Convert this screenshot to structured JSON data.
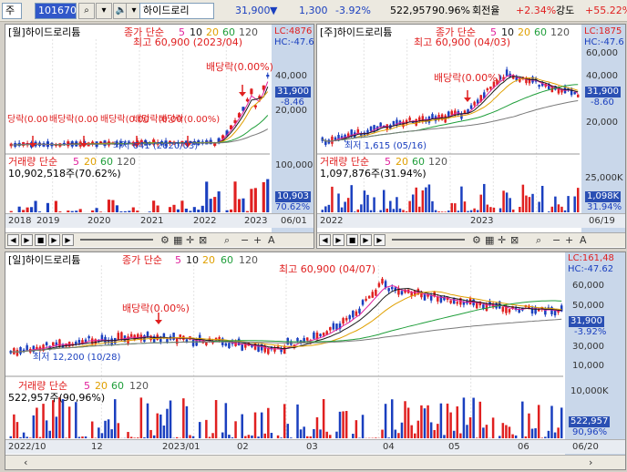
{
  "toolbar": {
    "market": "주",
    "code": "101670",
    "name": "하이드로리",
    "price": "31,900",
    "change": "1,300",
    "change_pct": "-3.92%",
    "volume": "522,957",
    "vol_ratio": "90.96%",
    "turnover_label": "회전율",
    "turnover": "+2.34%",
    "strength_label": "강도",
    "strength": "+55.22%"
  },
  "monthly": {
    "title": "[월]하이드로리튬",
    "ma_label": "종가 단순",
    "ma": [
      "5",
      "10",
      "20",
      "60",
      "120"
    ],
    "lc": "LC:4876",
    "hc": "HC:-47.6",
    "high": "최고 60,900 (2023/04)",
    "low": "최저 641 (2020/03)",
    "dividend": "배당락(0.00%)",
    "dividend_small": [
      "당락(0.00",
      "배당락(0.00",
      "배당락(0.00",
      "배당락(0.00",
      "배당락(0.00%)"
    ],
    "price_tag": "31,900",
    "price_pct": "-8.46",
    "y_ticks": [
      "40,000",
      "20,000"
    ],
    "vol_title": "거래량 단순",
    "vol_ma": [
      "5",
      "20",
      "60",
      "120"
    ],
    "vol_text": "10,902,518주(70.62%)",
    "vol_tick": "100,000",
    "vol_tag": "10,903",
    "vol_pct": "70.62%",
    "x_labels": [
      "2018",
      "2019",
      "2020",
      "2021",
      "2022",
      "2023"
    ],
    "x_end": "06/01"
  },
  "weekly": {
    "title": "[주]하이드로리튬",
    "ma_label": "종가 단순",
    "ma": [
      "5",
      "10",
      "20",
      "60",
      "120"
    ],
    "lc": "LC:1875",
    "hc": "HC:-47.6",
    "high": "최고 60,900 (04/03)",
    "low": "최저 1,615 (05/16)",
    "dividend": "배당락(0.00%)",
    "price_tag": "31,900",
    "price_pct": "-8.60",
    "y_ticks": [
      "60,000",
      "40,000",
      "20,000"
    ],
    "vol_title": "거래량 단순",
    "vol_ma": [
      "5",
      "20",
      "60",
      "120"
    ],
    "vol_text": "1,097,876주(31.94%)",
    "vol_tick": "25,000K",
    "vol_tag": "1,098K",
    "vol_pct": "31.94%",
    "x_labels": [
      "2022",
      "2023"
    ],
    "x_end": "06/19"
  },
  "daily": {
    "title": "[일]하이드로리튬",
    "ma_label": "종가 단순",
    "ma": [
      "5",
      "10",
      "20",
      "60",
      "120"
    ],
    "lc": "LC:161,48",
    "hc": "HC:-47.62",
    "high": "최고 60,900 (04/07)",
    "low": "최저 12,200 (10/28)",
    "dividend": "배당락(0.00%)",
    "price_tag": "31,900",
    "price_pct": "-3.92%",
    "y_ticks": [
      "60,000",
      "50,000",
      "40,000",
      "30,000",
      "20,000",
      "10,000"
    ],
    "vol_title": "거래량 단순",
    "vol_ma": [
      "5",
      "20",
      "60",
      "120"
    ],
    "vol_text": "522,957주(90,96%)",
    "vol_tick": "10,000K",
    "vol_tag": "522,957",
    "vol_pct": "90,96%",
    "x_labels": [
      "2022/10",
      "12",
      "2023/01",
      "02",
      "03",
      "04",
      "05",
      "06"
    ],
    "x_end": "06/20"
  },
  "colors": {
    "up": "#e02020",
    "down": "#1a3fbf",
    "ma5": "#e0209c",
    "ma10": "#1a1a1a",
    "ma20": "#e0a000",
    "ma60": "#1f9e3a",
    "ma120": "#7a7a7a"
  }
}
